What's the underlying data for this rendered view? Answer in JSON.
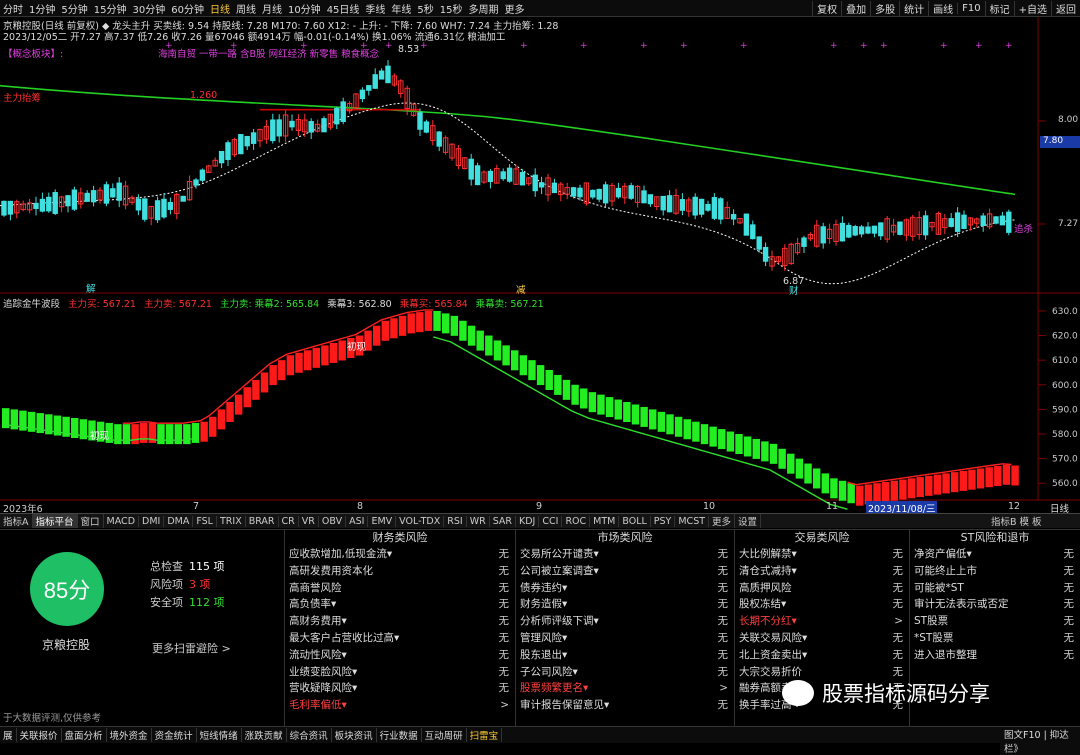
{
  "topbar": {
    "periods": [
      "分时",
      "1分钟",
      "5分钟",
      "15分钟",
      "30分钟",
      "60分钟",
      "日线",
      "周线",
      "月线",
      "10分钟",
      "45日线",
      "季线",
      "年线",
      "5秒",
      "15秒",
      "多周期",
      "更多"
    ],
    "active_period": "日线",
    "right_buttons": [
      "复权",
      "叠加",
      "多股",
      "统计",
      "画线",
      "F10",
      "标记",
      "+自选",
      "返回"
    ]
  },
  "info": {
    "line1": "京粮控股(日线 前复权) ◆ 龙头主升  买卖线: 9.54  持股线: 7.28  M170: 7.60  X12: -  上升: -  下降: 7.60  WH7: 7.24  主力抬筹: 1.28",
    "line2": "2023/12/05二  开7.27 高7.37 低7.26 收7.26 量67046 额4914万 幅-0.01(-0.14%) 换1.06% 流通6.31亿 粮油加工",
    "line3": "【概念板块】:",
    "concepts": "海南自贸 一带一路 含B股 网红经济 新零售 粮食概念"
  },
  "labels": {
    "zhuli": "主力抬筹",
    "zhuli_val": "1.260",
    "high": "8.53",
    "low": "6.87",
    "jie": "解",
    "jian": "减",
    "cai": "财",
    "zhuisha": "追杀"
  },
  "main_axis": {
    "ticks": [
      "8.00",
      "7.27"
    ],
    "current": "7.80"
  },
  "sub_axis": {
    "ticks": [
      "630.0",
      "620.0",
      "610.0",
      "600.0",
      "590.0",
      "580.0",
      "570.0",
      "560.0"
    ]
  },
  "sub": {
    "title": "追踪金牛波段",
    "l1": "主力买: 567.21",
    "l2": "主力卖: 567.21",
    "l3": "主力卖: 乘幕2: 565.84",
    "l4": "乘幕3: 562.80",
    "l5": "乘幕买: 565.84",
    "l6": "乘幕卖: 567.21",
    "chuxian1": "初现",
    "chuxian2": "初现"
  },
  "xaxis": {
    "labels": [
      "2023年6",
      "7",
      "8",
      "9",
      "10",
      "11",
      "12"
    ],
    "cursor": "2023/11/08/三",
    "right": "日线"
  },
  "indicator_tabs": [
    "指标A",
    "指标平台",
    "窗口",
    "MACD",
    "DMI",
    "DMA",
    "FSL",
    "TRIX",
    "BRAR",
    "CR",
    "VR",
    "OBV",
    "ASI",
    "EMV",
    "VOL-TDX",
    "RSI",
    "WR",
    "SAR",
    "KDJ",
    "CCI",
    "ROC",
    "MTM",
    "BOLL",
    "PSY",
    "MCST",
    "更多",
    "设置"
  ],
  "indicator_active": "指标平台",
  "indicator_right": "指标B  模 板",
  "risk": {
    "score": "85分",
    "stock": "京粮控股",
    "total_label": "总检查",
    "total": "115 项",
    "risk_label": "风险项",
    "risk": "3 项",
    "safe_label": "安全项",
    "safe": "112 项",
    "more": "更多扫雷避险 >"
  },
  "columns": [
    {
      "title": "财务类风险",
      "items": [
        {
          "t": "应收款增加,低现金流▾",
          "v": "无"
        },
        {
          "t": "高研发费用资本化",
          "v": "无"
        },
        {
          "t": "高商誉风险",
          "v": "无"
        },
        {
          "t": "高负债率▾",
          "v": "无"
        },
        {
          "t": "高财务费用▾",
          "v": "无"
        },
        {
          "t": "最大客户占营收比过高▾",
          "v": "无"
        },
        {
          "t": "流动性风险▾",
          "v": "无"
        },
        {
          "t": "业绩变脸风险▾",
          "v": "无"
        },
        {
          "t": "营收疑降风险▾",
          "v": "无"
        },
        {
          "t": "毛利率偏低▾",
          "v": ">",
          "red": true
        }
      ]
    },
    {
      "title": "市场类风险",
      "items": [
        {
          "t": "交易所公开谴责▾",
          "v": "无"
        },
        {
          "t": "公司被立案调查▾",
          "v": "无"
        },
        {
          "t": "债券违约▾",
          "v": "无"
        },
        {
          "t": "财务造假▾",
          "v": "无"
        },
        {
          "t": "分析师评级下调▾",
          "v": "无"
        },
        {
          "t": "管理风险▾",
          "v": "无"
        },
        {
          "t": "股东退出▾",
          "v": "无"
        },
        {
          "t": "子公司风险▾",
          "v": "无"
        },
        {
          "t": "股票频繁更名▾",
          "v": ">",
          "red": true
        },
        {
          "t": "审计报告保留意见▾",
          "v": "无"
        }
      ]
    },
    {
      "title": "交易类风险",
      "items": [
        {
          "t": "大比例解禁▾",
          "v": "无"
        },
        {
          "t": "清仓式减持▾",
          "v": "无"
        },
        {
          "t": "高质押风险",
          "v": "无"
        },
        {
          "t": "股权冻结▾",
          "v": "无"
        },
        {
          "t": "长期不分红▾",
          "v": ">",
          "red": true
        },
        {
          "t": "关联交易风险▾",
          "v": "无"
        },
        {
          "t": "北上资金卖出▾",
          "v": "无"
        },
        {
          "t": "大宗交易折价",
          "v": "无"
        },
        {
          "t": "融券高额卖出",
          "v": "无"
        },
        {
          "t": "换手率过高",
          "v": "无"
        }
      ]
    },
    {
      "title": "ST风险和退市",
      "items": [
        {
          "t": "净资产偏低▾",
          "v": "无"
        },
        {
          "t": "可能终止上市",
          "v": "无"
        },
        {
          "t": "可能被*ST",
          "v": "无"
        },
        {
          "t": "审计无法表示或否定",
          "v": "无"
        },
        {
          "t": "ST股票",
          "v": "无"
        },
        {
          "t": "*ST股票",
          "v": "无"
        },
        {
          "t": "进入退市整理",
          "v": "无"
        }
      ]
    }
  ],
  "watermark": "股票指标源码分享",
  "footnote": "于大数据评测,仅供参考",
  "status": {
    "items": [
      "展",
      "关联报价",
      "盘面分析",
      "境外资金",
      "资金统计",
      "短线情绪",
      "涨跌贡献",
      "综合资讯",
      "板块资讯",
      "行业数据",
      "互动周研",
      "扫雷宝"
    ],
    "active": "扫雷宝",
    "right": "图文F10  |  抑达栏》"
  },
  "chart_data": {
    "type": "candlestick+indicator",
    "main": {
      "y_ticks": [
        8.0,
        7.27
      ],
      "high_label": 8.53,
      "low_label": 6.87,
      "green_ma_start": 8.25,
      "green_ma_end": 7.48,
      "red_line": 8.08
    },
    "sub": {
      "y_range": [
        554,
        632
      ],
      "bars": [
        {
          "i": 0,
          "v": 590.5,
          "c": "g"
        },
        {
          "i": 1,
          "v": 590,
          "c": "g"
        },
        {
          "i": 2,
          "v": 589.5,
          "c": "g"
        },
        {
          "i": 3,
          "v": 589,
          "c": "g"
        },
        {
          "i": 4,
          "v": 588.5,
          "c": "g"
        },
        {
          "i": 5,
          "v": 588,
          "c": "g"
        },
        {
          "i": 6,
          "v": 587.5,
          "c": "g"
        },
        {
          "i": 7,
          "v": 587,
          "c": "g"
        },
        {
          "i": 8,
          "v": 586.5,
          "c": "g"
        },
        {
          "i": 9,
          "v": 586,
          "c": "g"
        },
        {
          "i": 10,
          "v": 585.5,
          "c": "g"
        },
        {
          "i": 11,
          "v": 585,
          "c": "g"
        },
        {
          "i": 12,
          "v": 584.5,
          "c": "g"
        },
        {
          "i": 13,
          "v": 584,
          "c": "g"
        },
        {
          "i": 14,
          "v": 584,
          "c": "g"
        },
        {
          "i": 15,
          "v": 584,
          "c": "r"
        },
        {
          "i": 16,
          "v": 584.5,
          "c": "r"
        },
        {
          "i": 17,
          "v": 584.5,
          "c": "r"
        },
        {
          "i": 18,
          "v": 584,
          "c": "g"
        },
        {
          "i": 19,
          "v": 584,
          "c": "g"
        },
        {
          "i": 20,
          "v": 584,
          "c": "g"
        },
        {
          "i": 21,
          "v": 584,
          "c": "g"
        },
        {
          "i": 22,
          "v": 584.5,
          "c": "g"
        },
        {
          "i": 23,
          "v": 585,
          "c": "r"
        },
        {
          "i": 24,
          "v": 587,
          "c": "r"
        },
        {
          "i": 25,
          "v": 590,
          "c": "r"
        },
        {
          "i": 26,
          "v": 593,
          "c": "r"
        },
        {
          "i": 27,
          "v": 596,
          "c": "r"
        },
        {
          "i": 28,
          "v": 599,
          "c": "r"
        },
        {
          "i": 29,
          "v": 602,
          "c": "r"
        },
        {
          "i": 30,
          "v": 605,
          "c": "r"
        },
        {
          "i": 31,
          "v": 608,
          "c": "r"
        },
        {
          "i": 32,
          "v": 610,
          "c": "r"
        },
        {
          "i": 33,
          "v": 612,
          "c": "r"
        },
        {
          "i": 34,
          "v": 613,
          "c": "r"
        },
        {
          "i": 35,
          "v": 614,
          "c": "r"
        },
        {
          "i": 36,
          "v": 615,
          "c": "r"
        },
        {
          "i": 37,
          "v": 616,
          "c": "r"
        },
        {
          "i": 38,
          "v": 617,
          "c": "r"
        },
        {
          "i": 39,
          "v": 618,
          "c": "r"
        },
        {
          "i": 40,
          "v": 619,
          "c": "r"
        },
        {
          "i": 41,
          "v": 620,
          "c": "r"
        },
        {
          "i": 42,
          "v": 622,
          "c": "r"
        },
        {
          "i": 43,
          "v": 624,
          "c": "r"
        },
        {
          "i": 44,
          "v": 626,
          "c": "r"
        },
        {
          "i": 45,
          "v": 627,
          "c": "r"
        },
        {
          "i": 46,
          "v": 628,
          "c": "r"
        },
        {
          "i": 47,
          "v": 629,
          "c": "r"
        },
        {
          "i": 48,
          "v": 629.5,
          "c": "r"
        },
        {
          "i": 49,
          "v": 630,
          "c": "r"
        },
        {
          "i": 50,
          "v": 630,
          "c": "g"
        },
        {
          "i": 51,
          "v": 629,
          "c": "g"
        },
        {
          "i": 52,
          "v": 628,
          "c": "g"
        },
        {
          "i": 53,
          "v": 626,
          "c": "g"
        },
        {
          "i": 54,
          "v": 624,
          "c": "g"
        },
        {
          "i": 55,
          "v": 622,
          "c": "g"
        },
        {
          "i": 56,
          "v": 620,
          "c": "g"
        },
        {
          "i": 57,
          "v": 618,
          "c": "g"
        },
        {
          "i": 58,
          "v": 616,
          "c": "g"
        },
        {
          "i": 59,
          "v": 614,
          "c": "g"
        },
        {
          "i": 60,
          "v": 612,
          "c": "g"
        },
        {
          "i": 61,
          "v": 610,
          "c": "g"
        },
        {
          "i": 62,
          "v": 608,
          "c": "g"
        },
        {
          "i": 63,
          "v": 606,
          "c": "g"
        },
        {
          "i": 64,
          "v": 604,
          "c": "g"
        },
        {
          "i": 65,
          "v": 602,
          "c": "g"
        },
        {
          "i": 66,
          "v": 600,
          "c": "g"
        },
        {
          "i": 67,
          "v": 598.5,
          "c": "g"
        },
        {
          "i": 68,
          "v": 597,
          "c": "g"
        },
        {
          "i": 69,
          "v": 596,
          "c": "g"
        },
        {
          "i": 70,
          "v": 595,
          "c": "g"
        },
        {
          "i": 71,
          "v": 594,
          "c": "g"
        },
        {
          "i": 72,
          "v": 593,
          "c": "g"
        },
        {
          "i": 73,
          "v": 592,
          "c": "g"
        },
        {
          "i": 74,
          "v": 591,
          "c": "g"
        },
        {
          "i": 75,
          "v": 590,
          "c": "g"
        },
        {
          "i": 76,
          "v": 589,
          "c": "g"
        },
        {
          "i": 77,
          "v": 588,
          "c": "g"
        },
        {
          "i": 78,
          "v": 587,
          "c": "g"
        },
        {
          "i": 79,
          "v": 586,
          "c": "g"
        },
        {
          "i": 80,
          "v": 585,
          "c": "g"
        },
        {
          "i": 81,
          "v": 584,
          "c": "g"
        },
        {
          "i": 82,
          "v": 583,
          "c": "g"
        },
        {
          "i": 83,
          "v": 582,
          "c": "g"
        },
        {
          "i": 84,
          "v": 581,
          "c": "g"
        },
        {
          "i": 85,
          "v": 580,
          "c": "g"
        },
        {
          "i": 86,
          "v": 579,
          "c": "g"
        },
        {
          "i": 87,
          "v": 578,
          "c": "g"
        },
        {
          "i": 88,
          "v": 577,
          "c": "g"
        },
        {
          "i": 89,
          "v": 576,
          "c": "g"
        },
        {
          "i": 90,
          "v": 574,
          "c": "g"
        },
        {
          "i": 91,
          "v": 572,
          "c": "g"
        },
        {
          "i": 92,
          "v": 570,
          "c": "g"
        },
        {
          "i": 93,
          "v": 568,
          "c": "g"
        },
        {
          "i": 94,
          "v": 566,
          "c": "g"
        },
        {
          "i": 95,
          "v": 564,
          "c": "g"
        },
        {
          "i": 96,
          "v": 562,
          "c": "g"
        },
        {
          "i": 97,
          "v": 561,
          "c": "g"
        },
        {
          "i": 98,
          "v": 560,
          "c": "g"
        },
        {
          "i": 99,
          "v": 559,
          "c": "r"
        },
        {
          "i": 100,
          "v": 559.5,
          "c": "r"
        },
        {
          "i": 101,
          "v": 560,
          "c": "r"
        },
        {
          "i": 102,
          "v": 560.5,
          "c": "r"
        },
        {
          "i": 103,
          "v": 561,
          "c": "r"
        },
        {
          "i": 104,
          "v": 561.5,
          "c": "r"
        },
        {
          "i": 105,
          "v": 562,
          "c": "r"
        },
        {
          "i": 106,
          "v": 562.5,
          "c": "r"
        },
        {
          "i": 107,
          "v": 563,
          "c": "r"
        },
        {
          "i": 108,
          "v": 563.5,
          "c": "r"
        },
        {
          "i": 109,
          "v": 564,
          "c": "r"
        },
        {
          "i": 110,
          "v": 564.5,
          "c": "r"
        },
        {
          "i": 111,
          "v": 565,
          "c": "r"
        },
        {
          "i": 112,
          "v": 565.5,
          "c": "r"
        },
        {
          "i": 113,
          "v": 566,
          "c": "r"
        },
        {
          "i": 114,
          "v": 566.5,
          "c": "r"
        },
        {
          "i": 115,
          "v": 567,
          "c": "r"
        },
        {
          "i": 116,
          "v": 567.5,
          "c": "r"
        },
        {
          "i": 117,
          "v": 567.2,
          "c": "r"
        }
      ]
    }
  }
}
